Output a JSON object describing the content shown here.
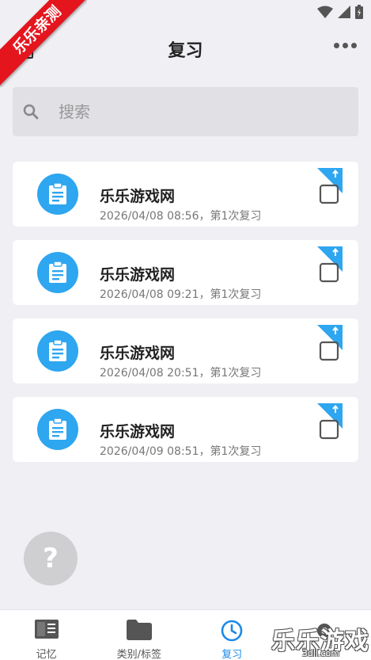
{
  "ribbon": {
    "text": "乐乐亲测"
  },
  "header": {
    "title": "复习"
  },
  "search": {
    "placeholder": "搜索"
  },
  "cards": [
    {
      "title": "乐乐游戏网",
      "subtitle": "2026/04/08 08:56，第1次复习"
    },
    {
      "title": "乐乐游戏网",
      "subtitle": "2026/04/08 09:21，第1次复习"
    },
    {
      "title": "乐乐游戏网",
      "subtitle": "2026/04/08 20:51，第1次复习"
    },
    {
      "title": "乐乐游戏网",
      "subtitle": "2026/04/09 08:51，第1次复习"
    }
  ],
  "help": {
    "label": "?"
  },
  "nav": {
    "items": [
      {
        "label": "记忆",
        "icon": "notebook-icon"
      },
      {
        "label": "类别/标签",
        "icon": "folder-icon"
      },
      {
        "label": "复习",
        "icon": "clock-icon",
        "active": true
      },
      {
        "label": "",
        "icon": "settings-icon"
      }
    ]
  },
  "watermark": {
    "text": "乐乐游戏",
    "sub": "3dll.com"
  },
  "colors": {
    "accent": "#2ea6f0",
    "active_nav": "#1c88e6",
    "ribbon": "#e5151e",
    "background": "#efeff4"
  }
}
